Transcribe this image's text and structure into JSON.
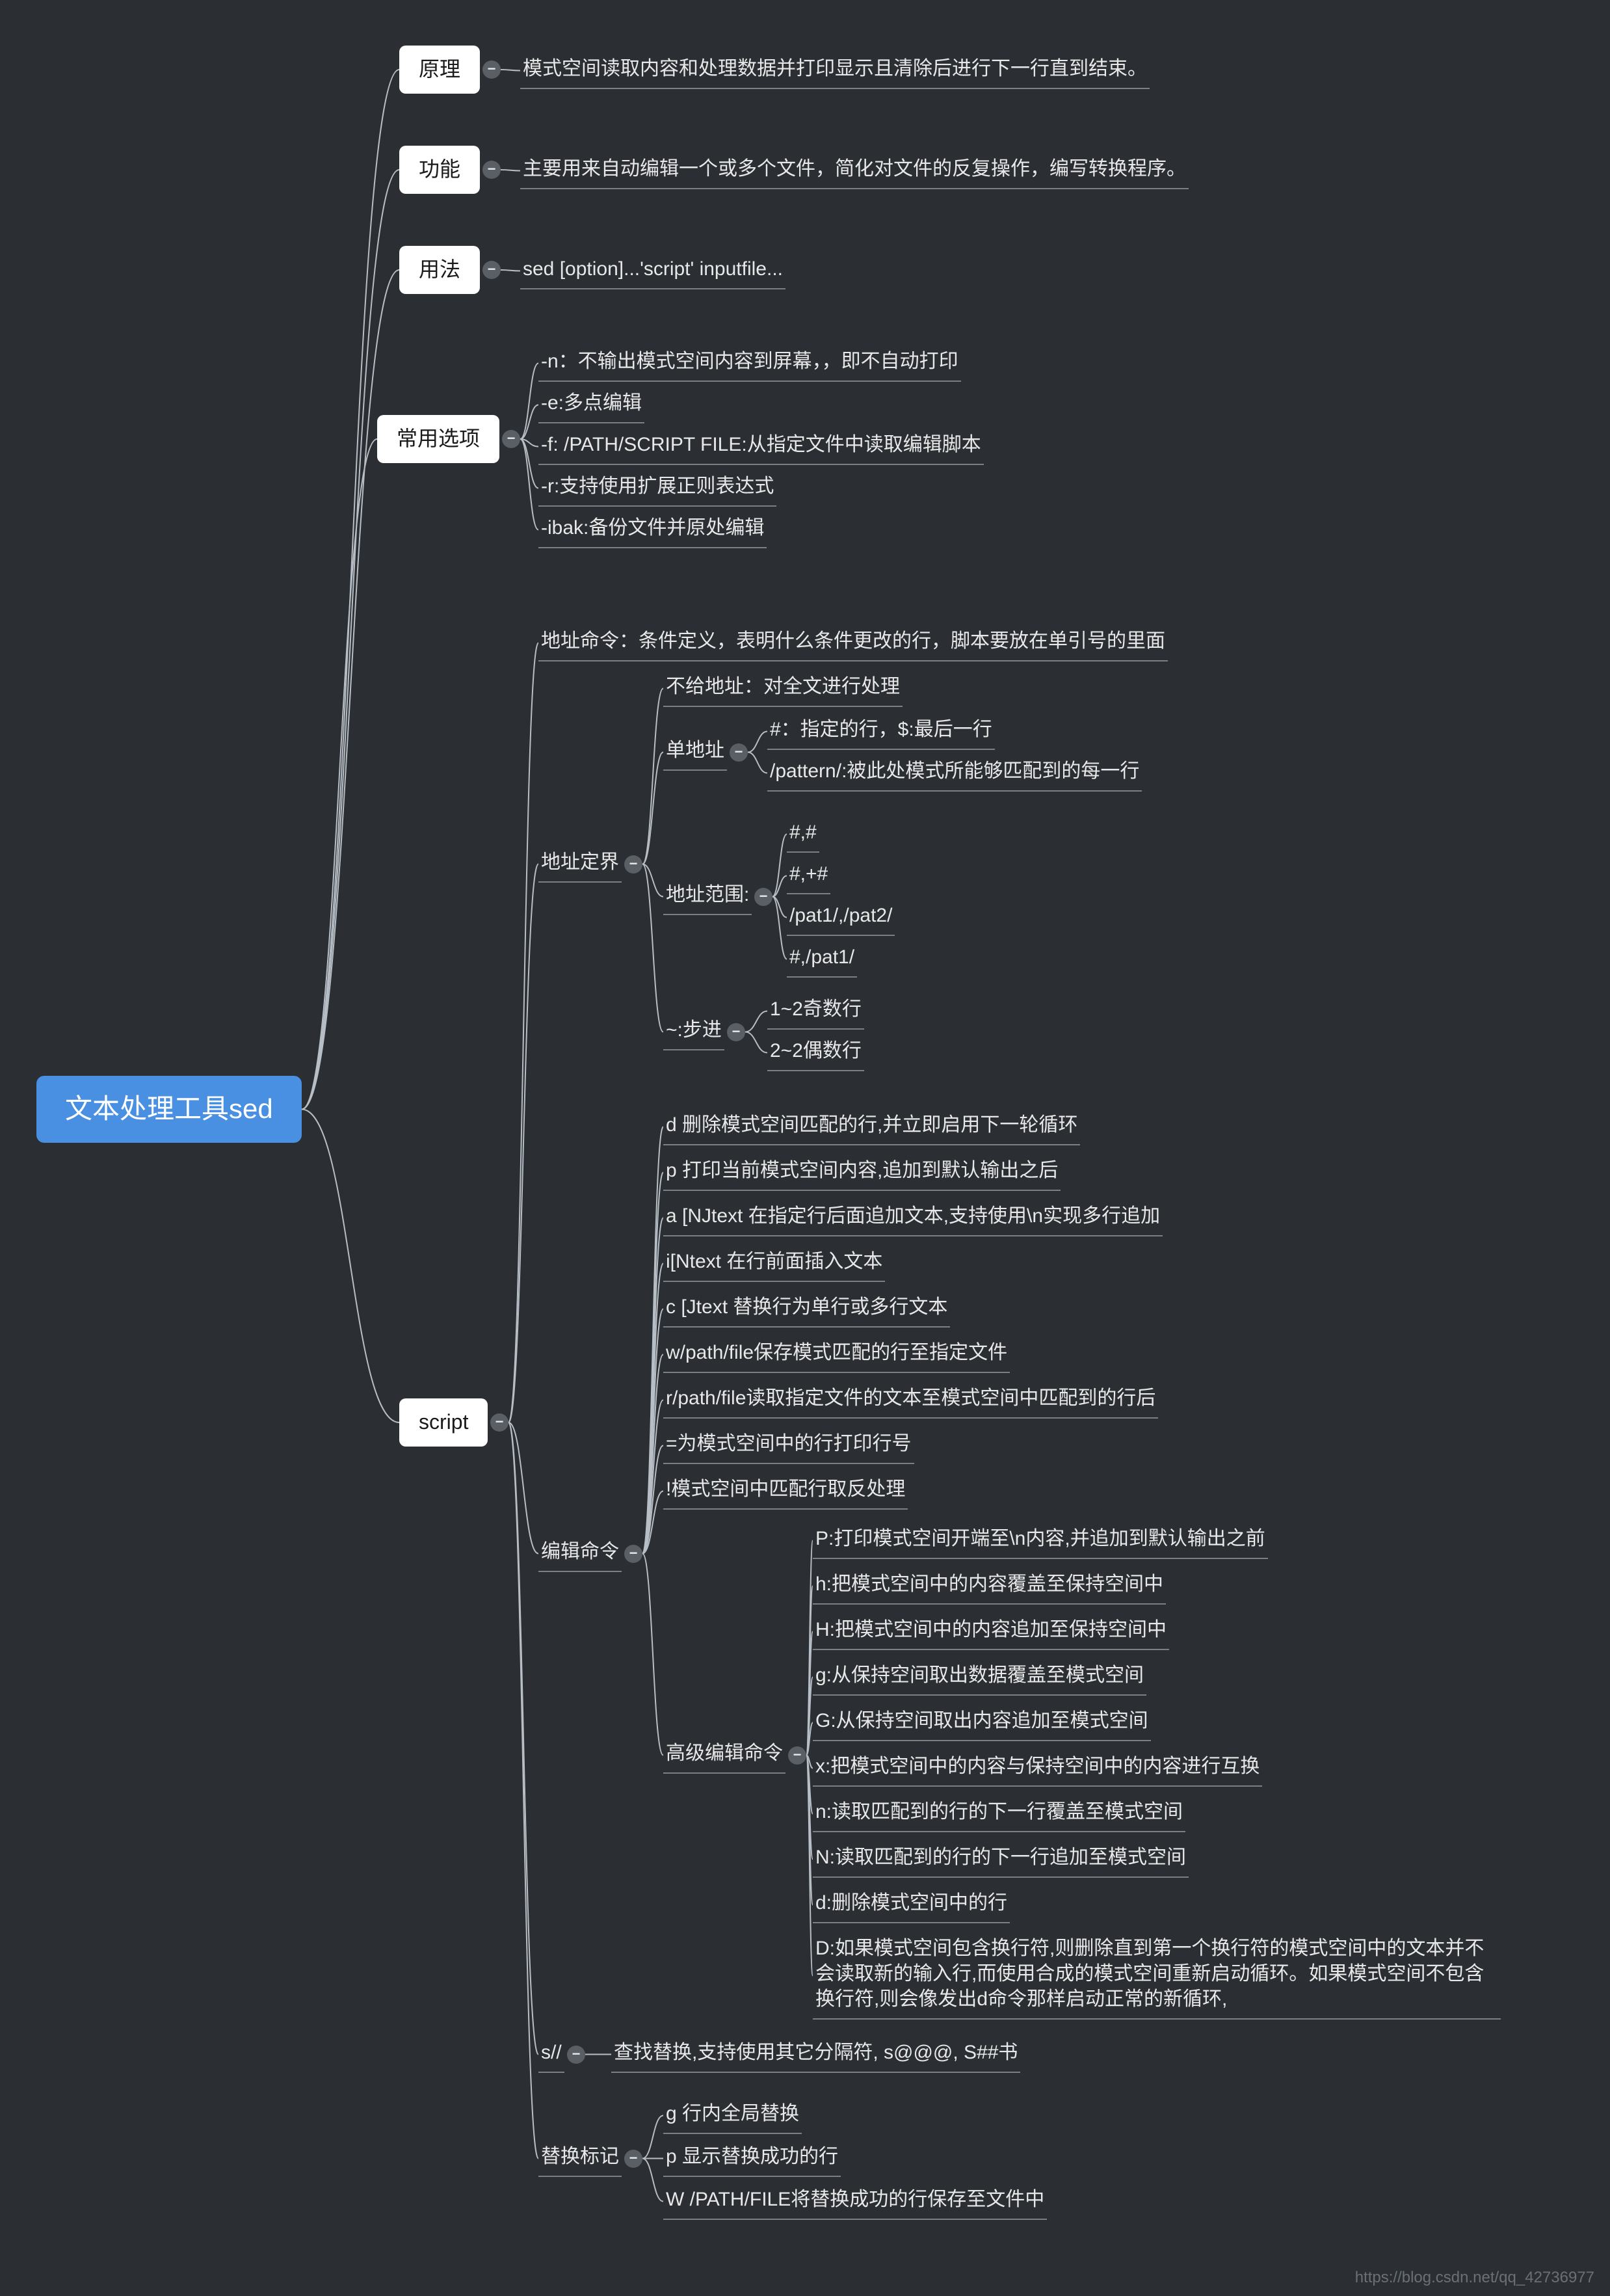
{
  "root": "文本处理工具sed",
  "n1": {
    "label": "原理",
    "desc": "模式空间读取内容和处理数据并打印显示且清除后进行下一行直到结束。"
  },
  "n2": {
    "label": "功能",
    "desc": "主要用来自动编辑一个或多个文件，简化对文件的反复操作，编写转换程序。"
  },
  "n3": {
    "label": "用法",
    "desc": "sed [option]...'script' inputfile..."
  },
  "n4": {
    "label": "常用选项",
    "items": [
      "-n：不输出模式空间内容到屏幕，，即不自动打印",
      "-e:多点编辑",
      "-f: /PATH/SCRIPT FILE:从指定文件中读取编辑脚本",
      "-r:支持使用扩展正则表达式",
      "-ibak:备份文件并原处编辑"
    ]
  },
  "script": {
    "label": "script",
    "addr_cmd": "地址命令：条件定义，表明什么条件更改的行，脚本要放在单引号的里面",
    "addr_bound": {
      "label": "地址定界",
      "no_addr": "不给地址：对全文进行处理",
      "single": {
        "label": "单地址",
        "items": [
          "#：指定的行，$:最后一行",
          "/pattern/:被此处模式所能够匹配到的每一行"
        ]
      },
      "range": {
        "label": "地址范围:",
        "items": [
          "#,#",
          "#,+#",
          "/pat1/,/pat2/",
          "#,/pat1/"
        ]
      },
      "step": {
        "label": "~:步进",
        "items": [
          "1~2奇数行",
          "2~2偶数行"
        ]
      }
    },
    "edit": {
      "label": "编辑命令",
      "basic": [
        "d 删除模式空间匹配的行,并立即启用下一轮循环",
        "p 打印当前模式空间内容,追加到默认输出之后",
        "a [NJtext 在指定行后面追加文本,支持使用\\n实现多行追加",
        "i[Ntext 在行前面插入文本",
        "c [Jtext 替换行为单行或多行文本",
        "w/path/file保存模式匹配的行至指定文件",
        "r/path/file读取指定文件的文本至模式空间中匹配到的行后",
        "=为模式空间中的行打印行号",
        "!模式空间中匹配行取反处理"
      ],
      "adv_label": "高级编辑命令",
      "adv": [
        "P:打印模式空间开端至\\n内容,并追加到默认输出之前",
        "h:把模式空间中的内容覆盖至保持空间中",
        "H:把模式空间中的内容追加至保持空间中",
        "g:从保持空间取出数据覆盖至模式空间",
        "G:从保持空间取出内容追加至模式空间",
        "x:把模式空间中的内容与保持空间中的内容进行互换",
        "n:读取匹配到的行的下一行覆盖至模式空间",
        "N:读取匹配到的行的下一行追加至模式空间",
        "d:删除模式空间中的行",
        "D:如果模式空间包含换行符,则删除直到第一个换行符的模式空间中的文本并不会读取新的输入行,而使用合成的模式空间重新启动循环。如果模式空间不包含换行符,则会像发出d命令那样启动正常的新循环,"
      ]
    },
    "subst": {
      "label": "s//",
      "desc": "查找替换,支持使用其它分隔符, s@@@, S##书"
    },
    "flags": {
      "label": "替换标记",
      "items": [
        "g 行内全局替换",
        "p 显示替换成功的行",
        "W /PATH/FILE将替换成功的行保存至文件中"
      ]
    }
  },
  "watermark": "https://blog.csdn.net/qq_42736977"
}
